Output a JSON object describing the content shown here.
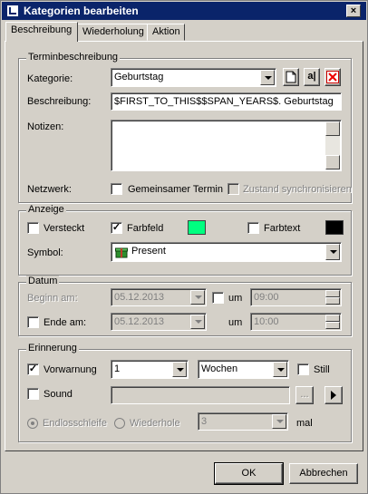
{
  "window": {
    "title": "Kategorien bearbeiten",
    "close_glyph": "×"
  },
  "tabs": [
    {
      "label": "Beschreibung",
      "active": true
    },
    {
      "label": "Wiederholung",
      "active": false
    },
    {
      "label": "Aktion",
      "active": false
    }
  ],
  "termin": {
    "legend": "Terminbeschreibung",
    "kategorie_label": "Kategorie:",
    "kategorie_value": "Geburtstag",
    "new_icon": "new-document-icon",
    "rename_icon": "rename-icon",
    "rename_glyph": "a|",
    "delete_icon": "delete-x-icon",
    "beschreibung_label": "Beschreibung:",
    "beschreibung_value": "$FIRST_TO_THIS$$SPAN_YEARS$. Geburtstag",
    "notizen_label": "Notizen:",
    "notizen_value": "",
    "netzwerk_label": "Netzwerk:",
    "gemeinsam_label": "Gemeinsamer Termin",
    "gemeinsam_checked": false,
    "sync_label": "Zustand synchronisieren",
    "sync_checked": false
  },
  "anzeige": {
    "legend": "Anzeige",
    "versteckt_label": "Versteckt",
    "versteckt_checked": false,
    "farbfeld_label": "Farbfeld",
    "farbfeld_checked": true,
    "farbfeld_color": "#00ff80",
    "farbtext_label": "Farbtext",
    "farbtext_checked": false,
    "farbtext_color": "#000000",
    "symbol_label": "Symbol:",
    "symbol_value": "Present",
    "symbol_icon": "present-icon"
  },
  "datum": {
    "legend": "Datum",
    "beginn_label": "Beginn am:",
    "beginn_date": "05.12.2013",
    "beginn_um_checked": false,
    "um_label": "um",
    "beginn_time": "09:00",
    "ende_checked": false,
    "ende_label": "Ende am:",
    "ende_date": "05.12.2013",
    "ende_um_label": "um",
    "ende_time": "10:00"
  },
  "erinnerung": {
    "legend": "Erinnerung",
    "vorwarnung_label": "Vorwarnung",
    "vorwarnung_checked": true,
    "vorwarnung_value": "1",
    "einheit_value": "Wochen",
    "still_label": "Still",
    "still_checked": false,
    "sound_label": "Sound",
    "sound_checked": false,
    "sound_value": "",
    "browse_label": "...",
    "play_icon": "play-icon",
    "endlos_label": "Endlosschleife",
    "wiederhole_label": "Wiederhole",
    "repeat_value": "3",
    "mal_label": "mal"
  },
  "buttons": {
    "ok": "OK",
    "cancel": "Abbrechen"
  }
}
